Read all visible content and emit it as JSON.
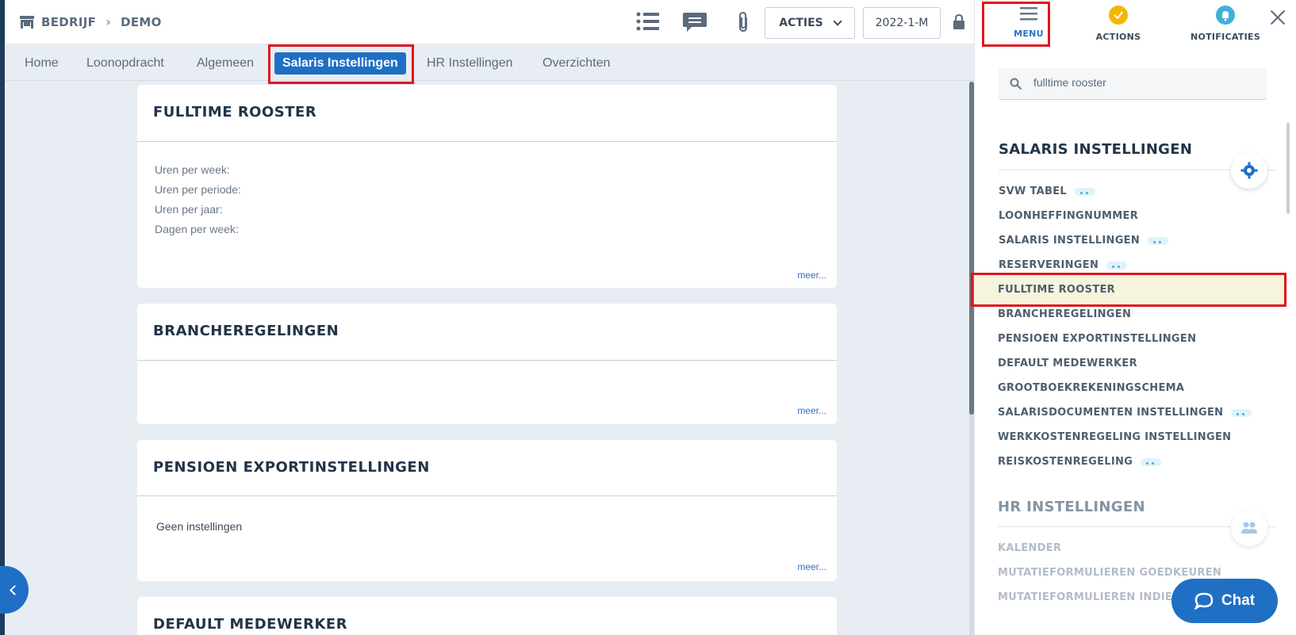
{
  "breadcrumb": {
    "root": "BEDRIJF",
    "current": "DEMO"
  },
  "header": {
    "acties_label": "ACTIES",
    "period_label": "2022-1-M"
  },
  "tabs": [
    {
      "label": "Home"
    },
    {
      "label": "Loonopdracht"
    },
    {
      "label": "Algemeen"
    },
    {
      "label": "Salaris Instellingen",
      "active": true
    },
    {
      "label": "HR Instellingen"
    },
    {
      "label": "Overzichten"
    }
  ],
  "cards": {
    "fulltime": {
      "title": "FULLTIME ROOSTER",
      "fields": [
        "Uren per week:",
        "Uren per periode:",
        "Uren per jaar:",
        "Dagen per week:"
      ],
      "more": "meer..."
    },
    "branche": {
      "title": "BRANCHEREGELINGEN",
      "more": "meer..."
    },
    "pensioen": {
      "title": "PENSIOEN EXPORTINSTELLINGEN",
      "text": "Geen instellingen",
      "more": "meer..."
    },
    "default": {
      "title": "DEFAULT MEDEWERKER"
    }
  },
  "panel": {
    "tabs": [
      {
        "label": "MENU",
        "active": true
      },
      {
        "label": "ACTIONS"
      },
      {
        "label": "NOTIFICATIES"
      }
    ],
    "search_value": "fulltime rooster",
    "section1": "SALARIS INSTELLINGEN",
    "items": [
      {
        "label": "SVW TABEL",
        "dots": true
      },
      {
        "label": "LOONHEFFINGNUMMER"
      },
      {
        "label": "SALARIS INSTELLINGEN",
        "dots": true
      },
      {
        "label": "RESERVERINGEN",
        "dots": true
      },
      {
        "label": "FULLTIME ROOSTER",
        "highlighted": true
      },
      {
        "label": "BRANCHEREGELINGEN"
      },
      {
        "label": "PENSIOEN EXPORTINSTELLINGEN"
      },
      {
        "label": "DEFAULT MEDEWERKER"
      },
      {
        "label": "GROOTBOEKREKENINGSCHEMA"
      },
      {
        "label": "SALARISDOCUMENTEN INSTELLINGEN",
        "dots": true
      },
      {
        "label": "WERKKOSTENREGELING INSTELLINGEN"
      },
      {
        "label": "REISKOSTENREGELING",
        "dots": true
      }
    ],
    "section2": "HR INSTELLINGEN",
    "hr_items": [
      {
        "label": "KALENDER"
      },
      {
        "label": "MUTATIEFORMULIEREN GOEDKEUREN"
      },
      {
        "label": "MUTATIEFORMULIEREN INDIENEN"
      }
    ]
  },
  "chat": {
    "label": "Chat"
  },
  "colors": {
    "accent": "#1f6fc5",
    "highlight": "#f6f4dc",
    "annotation": "#e0161e",
    "actions_badge": "#f2b705",
    "notif_badge": "#3fb0d8"
  }
}
